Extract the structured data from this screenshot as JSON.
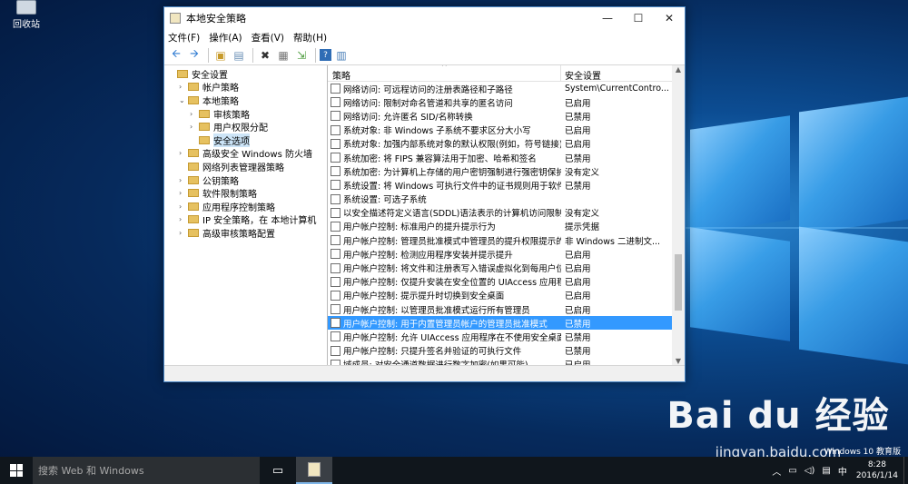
{
  "desktop": {
    "recycle_bin_label": "回收站",
    "watermark_logo": "Bai du 经验",
    "watermark_url": "jingyan.baidu.com",
    "edition": "Windows 10 教育版"
  },
  "window": {
    "title": "本地安全策略",
    "minimize": "—",
    "maximize": "☐",
    "close": "✕"
  },
  "menu": [
    "文件(F)",
    "操作(A)",
    "查看(V)",
    "帮助(H)"
  ],
  "tree": [
    {
      "label": "安全设置",
      "expand": "",
      "indent": 0
    },
    {
      "label": "帐户策略",
      "expand": "›",
      "indent": 1
    },
    {
      "label": "本地策略",
      "expand": "⌄",
      "indent": 1
    },
    {
      "label": "审核策略",
      "expand": "›",
      "indent": 2
    },
    {
      "label": "用户权限分配",
      "expand": "›",
      "indent": 2
    },
    {
      "label": "安全选项",
      "expand": "",
      "indent": 2,
      "selected": true
    },
    {
      "label": "高级安全 Windows 防火墙",
      "expand": "›",
      "indent": 1
    },
    {
      "label": "网络列表管理器策略",
      "expand": "",
      "indent": 1
    },
    {
      "label": "公钥策略",
      "expand": "›",
      "indent": 1
    },
    {
      "label": "软件限制策略",
      "expand": "›",
      "indent": 1
    },
    {
      "label": "应用程序控制策略",
      "expand": "›",
      "indent": 1
    },
    {
      "label": "IP 安全策略，在 本地计算机",
      "expand": "›",
      "indent": 1
    },
    {
      "label": "高级审核策略配置",
      "expand": "›",
      "indent": 1
    }
  ],
  "list": {
    "col_policy": "策略",
    "col_setting": "安全设置",
    "sort_caret": "^",
    "rows": [
      {
        "policy": "网络访问: 可远程访问的注册表路径和子路径",
        "setting": "System\\CurrentContro..."
      },
      {
        "policy": "网络访问: 限制对命名管道和共享的匿名访问",
        "setting": "已启用"
      },
      {
        "policy": "网络访问: 允许匿名 SID/名称转换",
        "setting": "已禁用"
      },
      {
        "policy": "系统对象: 非 Windows 子系统不要求区分大小写",
        "setting": "已启用"
      },
      {
        "policy": "系统对象: 加强内部系统对象的默认权限(例如，符号链接)",
        "setting": "已启用"
      },
      {
        "policy": "系统加密: 将 FIPS 兼容算法用于加密、哈希和签名",
        "setting": "已禁用"
      },
      {
        "policy": "系统加密: 为计算机上存储的用户密钥强制进行强密钥保护",
        "setting": "没有定义"
      },
      {
        "policy": "系统设置: 将 Windows 可执行文件中的证书规则用于软件...",
        "setting": "已禁用"
      },
      {
        "policy": "系统设置: 可选子系统",
        "setting": ""
      },
      {
        "policy": "以安全描述符定义语言(SDDL)语法表示的计算机访问限制",
        "setting": "没有定义"
      },
      {
        "policy": "用户帐户控制: 标准用户的提升提示行为",
        "setting": "提示凭据"
      },
      {
        "policy": "用户帐户控制: 管理员批准模式中管理员的提升权限提示的...",
        "setting": "非 Windows 二进制文..."
      },
      {
        "policy": "用户帐户控制: 检测应用程序安装并提示提升",
        "setting": "已启用"
      },
      {
        "policy": "用户帐户控制: 将文件和注册表写入错误虚拟化到每用户位置",
        "setting": "已启用"
      },
      {
        "policy": "用户帐户控制: 仅提升安装在安全位置的 UIAccess 应用程序",
        "setting": "已启用"
      },
      {
        "policy": "用户帐户控制: 提示提升时切换到安全桌面",
        "setting": "已启用"
      },
      {
        "policy": "用户帐户控制: 以管理员批准模式运行所有管理员",
        "setting": "已启用"
      },
      {
        "policy": "用户帐户控制: 用于内置管理员帐户的管理员批准模式",
        "setting": "已禁用",
        "selected": true
      },
      {
        "policy": "用户帐户控制: 允许 UIAccess 应用程序在不使用安全桌面...",
        "setting": "已禁用"
      },
      {
        "policy": "用户帐户控制: 只提升签名并验证的可执行文件",
        "setting": "已禁用"
      },
      {
        "policy": "域成员: 对安全通道数据进行数字加密(如果可能)",
        "setting": "已启用"
      }
    ]
  },
  "taskbar": {
    "search_placeholder": "搜索 Web 和 Windows",
    "ime": "中",
    "time": "8:28",
    "date": "2016/1/14"
  }
}
